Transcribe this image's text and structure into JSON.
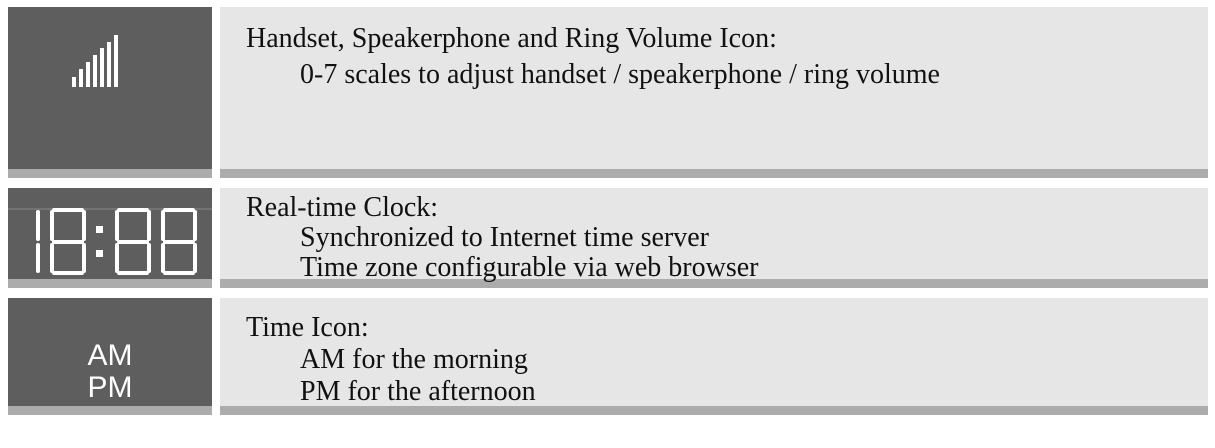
{
  "rows": [
    {
      "icon": "volume-bars-icon",
      "title": "Handset, Speakerphone and Ring Volume Icon:",
      "lines": [
        "0-7 scales to adjust handset / speakerphone / ring volume"
      ]
    },
    {
      "icon": "seven-segment-clock-icon",
      "title": "Real-time Clock:",
      "lines": [
        "Synchronized to Internet time server",
        "Time zone configurable via web browser"
      ]
    },
    {
      "icon": "am-pm-icon",
      "icon_text": [
        "AM",
        "PM"
      ],
      "title": "Time Icon:",
      "lines": [
        "AM for the morning",
        "PM for the afternoon"
      ]
    }
  ],
  "colors": {
    "icon_bg": "#5e5e5e",
    "desc_bg": "#e6e6e6",
    "border": "#acacac",
    "icon_fg": "#ffffff"
  }
}
